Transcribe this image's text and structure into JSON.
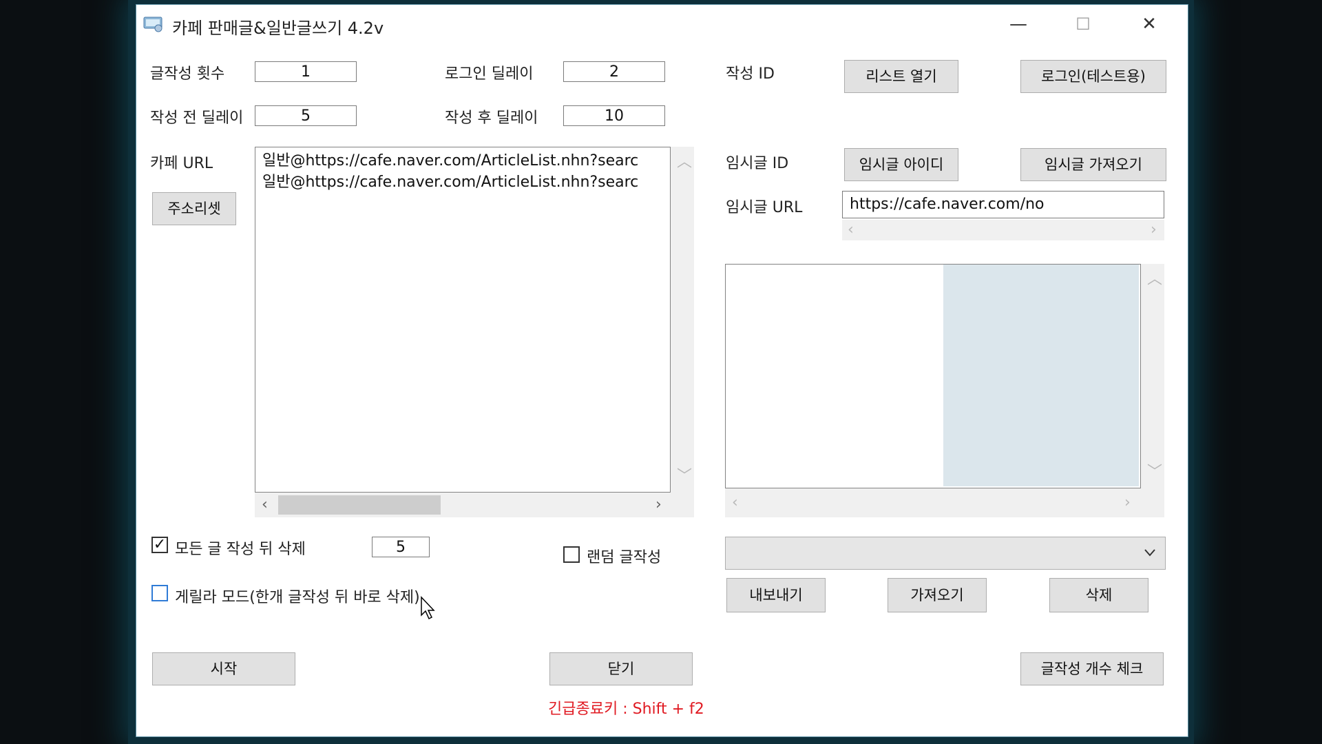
{
  "window": {
    "title": "카페 판매글&일반글쓰기 4.2v",
    "minimize": "—",
    "maximize": "☐",
    "close": "✕"
  },
  "fields": {
    "post_count_label": "글작성 횟수",
    "post_count_value": "1",
    "login_delay_label": "로그인 딜레이",
    "login_delay_value": "2",
    "pre_delay_label": "작성 전 딜레이",
    "pre_delay_value": "5",
    "post_delay_label": "작성 후 딜레이",
    "post_delay_value": "10",
    "writer_id_label": "작성 ID",
    "cafe_url_label": "카페 URL",
    "temp_id_label": "임시글 ID",
    "temp_url_label": "임시글 URL",
    "temp_url_value": "https://cafe.naver.com/no"
  },
  "buttons": {
    "list_open": "리스트 열기",
    "login_test": "로그인(테스트용)",
    "address_reset": "주소리셋",
    "temp_id": "임시글 아이디",
    "temp_fetch": "임시글 가져오기",
    "export": "내보내기",
    "import": "가져오기",
    "delete": "삭제",
    "start": "시작",
    "close": "닫기",
    "count_check": "글작성 개수 체크"
  },
  "cafe_urls": [
    "일반@https://cafe.naver.com/ArticleList.nhn?searc",
    "일반@https://cafe.naver.com/ArticleList.nhn?searc"
  ],
  "options": {
    "delete_after_all_label": "모든 글 작성 뒤 삭제",
    "delete_after_all_checked": true,
    "delete_after_all_value": "5",
    "random_post_label": "랜덤 글작성",
    "random_post_checked": false,
    "guerrilla_label": "게릴라 모드(한개 글작성 뒤 바로 삭제)",
    "guerrilla_checked": false
  },
  "footer": {
    "emergency_key": "긴급종료키 : Shift + f2"
  },
  "colors": {
    "accent_red": "#e01a22",
    "checkbox_blue": "#2f7bd6"
  }
}
